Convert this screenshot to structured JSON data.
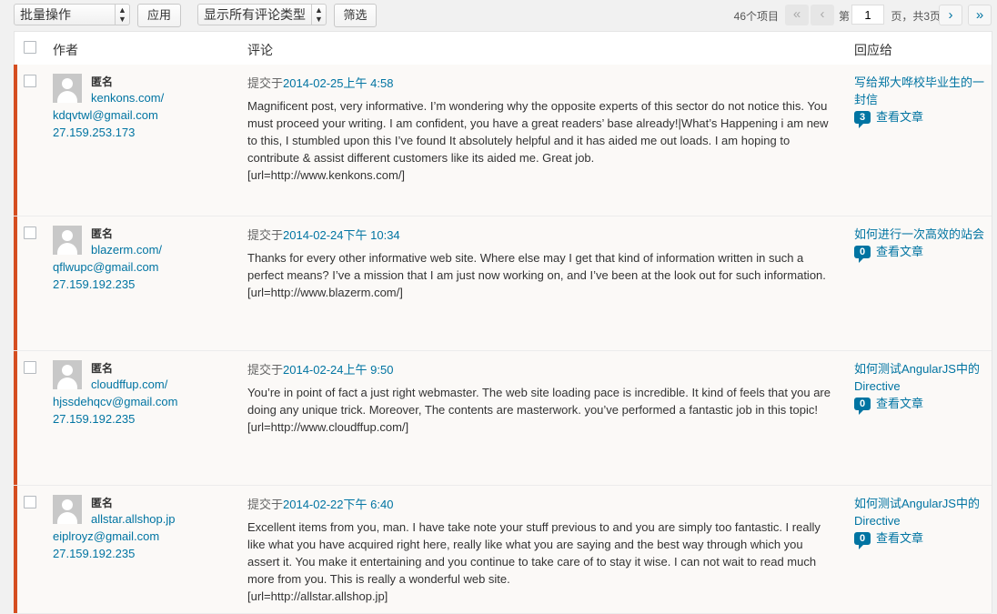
{
  "toolbar": {
    "bulk_actions": "批量操作",
    "apply": "应用",
    "comment_type_filter": "显示所有评论类型",
    "filter": "筛选"
  },
  "pagination": {
    "items_count": "46个项目",
    "first": "«",
    "prev": "‹",
    "page_prefix": "第",
    "current_page": "1",
    "page_suffix": "页，共3页",
    "next": "›",
    "last": "»"
  },
  "table": {
    "headers": {
      "author": "作者",
      "comment": "评论",
      "response": "回应给"
    },
    "rows": [
      {
        "author_name": "匿名",
        "author_url": "kenkons.com/",
        "email": "kdqvtwl@gmail.com",
        "ip": "27.159.253.173",
        "submitted_prefix": "提交于",
        "submitted_date": "2014-02-25上午 4:58",
        "text": "Magnificent post, very informative. I’m wondering why the opposite experts of this sector do not notice this. You must proceed your writing. I am confident, you have a great readers’ base already!|What’s Happening i am new to this, I stumbled upon this I’ve found It absolutely helpful and it has aided me out loads. I am hoping to contribute & assist different customers like its aided me. Great job.",
        "url_line": "[url=http://www.kenkons.com/]",
        "post_title": "写给郑大哗校毕业生的一封信",
        "comment_count": "3",
        "view_post": "查看文章"
      },
      {
        "author_name": "匿名",
        "author_url": "blazerm.com/",
        "email": "qflwupc@gmail.com",
        "ip": "27.159.192.235",
        "submitted_prefix": "提交于",
        "submitted_date": "2014-02-24下午 10:34",
        "text": "Thanks for every other informative web site. Where else may I get that kind of information written in such a perfect means? I’ve a mission that I am just now working on, and I’ve been at the look out for such information.",
        "url_line": "[url=http://www.blazerm.com/]",
        "post_title": "如何进行一次高效的站会",
        "comment_count": "0",
        "view_post": "查看文章"
      },
      {
        "author_name": "匿名",
        "author_url": "cloudffup.com/",
        "email": "hjssdehqcv@gmail.com",
        "ip": "27.159.192.235",
        "submitted_prefix": "提交于",
        "submitted_date": "2014-02-24上午 9:50",
        "text": "You’re in point of fact a just right webmaster. The web site loading pace is incredible. It kind of feels that you are doing any unique trick. Moreover, The contents are masterwork. you’ve performed a fantastic job in this topic!",
        "url_line": "[url=http://www.cloudffup.com/]",
        "post_title": "如何测试AngularJS中的Directive",
        "comment_count": "0",
        "view_post": "查看文章"
      },
      {
        "author_name": "匿名",
        "author_url": "allstar.allshop.jp",
        "email": "eiplroyz@gmail.com",
        "ip": "27.159.192.235",
        "submitted_prefix": "提交于",
        "submitted_date": "2014-02-22下午 6:40",
        "text": "Excellent items from you, man. I have take note your stuff previous to and you are simply too fantastic. I really like what you have acquired right here, really like what you are saying and the best way through which you assert it. You make it entertaining and you continue to take care of to stay it wise. I can not wait to read much more from you. This is really a wonderful web site.",
        "url_line": "[url=http://allstar.allshop.jp]",
        "post_title": "如何测试AngularJS中的Directive",
        "comment_count": "0",
        "view_post": "查看文章"
      }
    ]
  }
}
